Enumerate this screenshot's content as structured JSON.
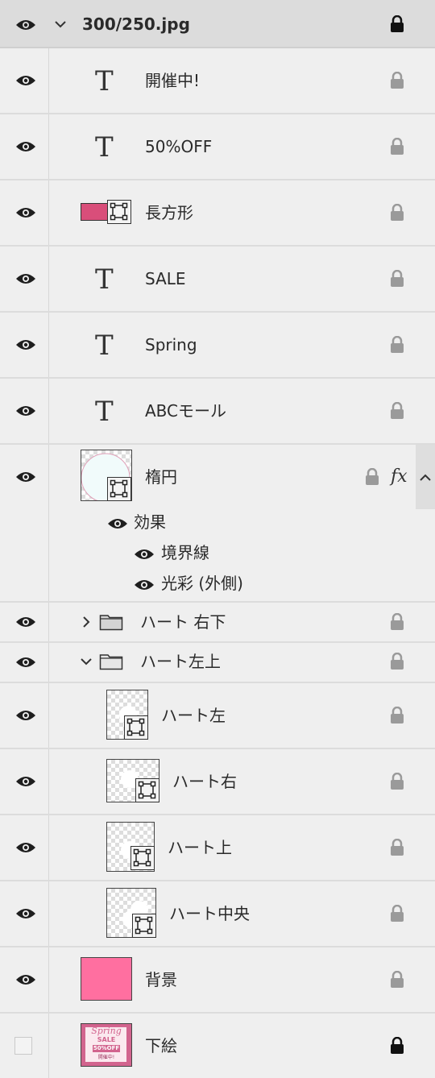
{
  "layers": {
    "root": {
      "name": "300/250.jpg"
    },
    "kaisai": {
      "name": "開催中!"
    },
    "off": {
      "name": "50%OFF"
    },
    "rect": {
      "name": "長方形",
      "swatch": "#d94e7a"
    },
    "sale": {
      "name": "SALE"
    },
    "spring": {
      "name": "Spring"
    },
    "abc": {
      "name": "ABCモール"
    },
    "ellipse": {
      "name": "楕円",
      "fx": "fx",
      "effects_label": "効果",
      "effects": [
        "境界線",
        "光彩 (外側)"
      ]
    },
    "heart_br": {
      "name": "ハート 右下"
    },
    "heart_tl": {
      "name": "ハート左上"
    },
    "heart_left": {
      "name": "ハート左"
    },
    "heart_right": {
      "name": "ハート右"
    },
    "heart_top": {
      "name": "ハート上"
    },
    "heart_center": {
      "name": "ハート中央"
    },
    "background": {
      "name": "背景",
      "color": "#ff6fa0"
    },
    "sketch": {
      "name": "下絵",
      "thumb": {
        "word": "Spring",
        "sale": "SALE",
        "off": "50%OFF",
        "footer": "開催中!"
      }
    }
  },
  "icons": {
    "visibility": "eye-icon",
    "lock": "lock-icon",
    "text_layer": "T",
    "shape": "shape-icon",
    "folder": "folder-icon"
  }
}
